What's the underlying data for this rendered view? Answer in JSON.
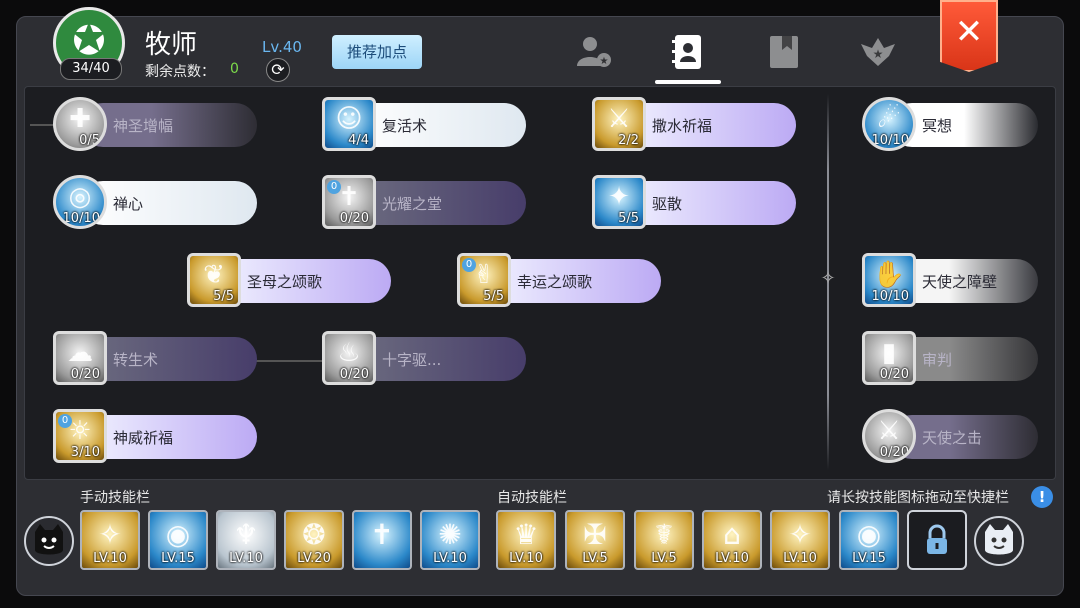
{
  "header": {
    "job_title": "牧师",
    "skill_points_used": "34/40",
    "remaining_label": "剩余点数：",
    "remaining_value": "0",
    "level": "Lv.40",
    "recommend_button": "推荐加点"
  },
  "tabs": [
    {
      "name": "tab-character",
      "icon": "user-star-icon",
      "active": false
    },
    {
      "name": "tab-skills",
      "icon": "contact-book-icon",
      "active": true
    },
    {
      "name": "tab-book",
      "icon": "bookmark-book-icon",
      "active": false
    },
    {
      "name": "tab-emblem",
      "icon": "winged-star-emblem-icon",
      "active": false
    }
  ],
  "close_icon": "✕",
  "skills": [
    {
      "name": "神圣增幅",
      "level": "0/5",
      "style": "gray"
    },
    {
      "name": "复活术",
      "level": "4/4",
      "style": "blue"
    },
    {
      "name": "撒水祈福",
      "level": "2/2",
      "style": "gold"
    },
    {
      "name": "冥想",
      "level": "10/10",
      "style": "blue"
    },
    {
      "name": "禅心",
      "level": "10/10",
      "style": "blue"
    },
    {
      "name": "光耀之堂",
      "level": "0/20",
      "style": "gray",
      "badge": "0"
    },
    {
      "name": "驱散",
      "level": "5/5",
      "style": "blue"
    },
    {
      "name": "圣母之颂歌",
      "level": "5/5",
      "style": "gold"
    },
    {
      "name": "幸运之颂歌",
      "level": "5/5",
      "style": "gold",
      "badge": "0"
    },
    {
      "name": "天使之障壁",
      "level": "10/10",
      "style": "blue"
    },
    {
      "name": "转生术",
      "level": "0/20",
      "style": "gray"
    },
    {
      "name": "十字驱...",
      "level": "0/20",
      "style": "gray"
    },
    {
      "name": "审判",
      "level": "0/20",
      "style": "gray"
    },
    {
      "name": "神威祈福",
      "level": "3/10",
      "style": "gold",
      "badge": "0"
    },
    {
      "name": "天使之击",
      "level": "0/20",
      "style": "gray"
    }
  ],
  "bars": {
    "manual_label": "手动技能栏",
    "auto_label": "自动技能栏",
    "hint": "请长按技能图标拖动至快捷栏",
    "hint_icon": "!",
    "manual_slots": [
      {
        "level": "LV.10",
        "style": "gold"
      },
      {
        "level": "LV.15",
        "style": "blue"
      },
      {
        "level": "LV.10",
        "style": "white"
      },
      {
        "level": "LV.20",
        "style": "gold"
      },
      {
        "level": "",
        "style": "blue"
      },
      {
        "level": "LV.10",
        "style": "blue"
      }
    ],
    "auto_slots": [
      {
        "level": "LV.10",
        "style": "gold"
      },
      {
        "level": "LV.5",
        "style": "gold"
      },
      {
        "level": "LV.5",
        "style": "gold"
      },
      {
        "level": "LV.10",
        "style": "gold"
      },
      {
        "level": "LV.10",
        "style": "gold"
      },
      {
        "level": "LV.15",
        "style": "blue"
      }
    ]
  },
  "colors": {
    "remaining_value": "#7ddc4b",
    "level_text": "#6ab7f0",
    "close_button": "#e8452a"
  }
}
